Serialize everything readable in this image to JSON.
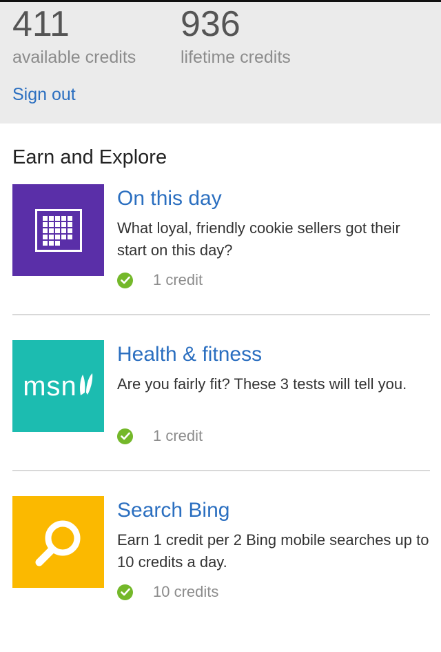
{
  "stats": {
    "available": {
      "value": "411",
      "label": "available credits"
    },
    "lifetime": {
      "value": "936",
      "label": "lifetime credits"
    },
    "signout_label": "Sign out"
  },
  "section": {
    "title": "Earn and Explore"
  },
  "offers": [
    {
      "title": "On this day",
      "description": "What loyal, friendly cookie sellers got their start on this day?",
      "credits": "1 credit",
      "icon": "calendar-icon",
      "tile_color": "#5a2fa8"
    },
    {
      "title": "Health & fitness",
      "description": "Are you fairly fit? These 3 tests will tell you.",
      "credits": "1 credit",
      "icon": "msn-logo",
      "logo_text": "msn",
      "tile_color": "#1cbcb0"
    },
    {
      "title": "Search Bing",
      "description": "Earn 1 credit per 2 Bing mobile searches up to 10 credits a day.",
      "credits": "10 credits",
      "icon": "search-icon",
      "tile_color": "#fbb900"
    }
  ],
  "colors": {
    "accent_link": "#2b6fc0",
    "check_green": "#74b82a",
    "panel_bg": "#ebebeb"
  }
}
